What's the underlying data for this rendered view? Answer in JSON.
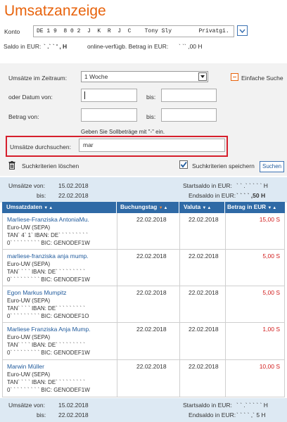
{
  "page": {
    "title": "Umsatzanzeige"
  },
  "account": {
    "label": "Konto",
    "selected": "DE 1 9  8 0 2  J  K  R  J  C    Tony Sly        Privatgi."
  },
  "balance_line": {
    "saldo_label": "Saldo in EUR:",
    "saldo_value": "` .` ` '  ,   H",
    "available_label": "online-verfügb. Betrag in EUR:",
    "available_value": "` `` ,00 H"
  },
  "filters": {
    "period_label": "Umsätze im Zeitraum:",
    "period_value": "1 Woche",
    "simple_search": "Einfache Suche",
    "date_from_label": "oder Datum von:",
    "date_to_label": "bis:",
    "amount_from_label": "Betrag von:",
    "amount_to_label": "bis:",
    "hint": "Geben Sie Sollbeträge mit \"-\" ein.",
    "search_label": "Umsätze durchsuchen:",
    "search_value": "mar",
    "clear_label": "Suchkriterien löschen",
    "save_label": "Suchkriterien speichern",
    "search_button": "Suchen"
  },
  "summary_top": {
    "from_label": "Umsätze von:",
    "from_value": "15.02.2018",
    "to_label": "bis:",
    "to_value": "22.02.2018",
    "start_label": "Startsaldo in EUR:",
    "start_value": "` ` .` ` ` ` ` H",
    "end_label": "Endsaldo in EUR:",
    "end_value": "` ` ` ` ,50 H"
  },
  "table": {
    "headers": [
      "Umsatzdaten",
      "Buchungstag",
      "Valuta",
      "Betrag in EUR"
    ],
    "rows": [
      {
        "name": "Marliese-Franziska AntoniaMu.",
        "line2": "Euro-UW (SEPA)",
        "line3": "TAN` 4` 1` IBAN: DE` ` ` ` ` ` ` ` `",
        "line4": "0` ` ` ` ` ` ` ` ` BIC: GENODEF1W",
        "buchungstag": "22.02.2018",
        "valuta": "22.02.2018",
        "betrag": "15,00 S"
      },
      {
        "name": "marliese-franziska anja mump.",
        "line2": "Euro-UW (SEPA)",
        "line3": "TAN` ` ` ` IBAN: DE` ` ` ` ` ` ` ` `",
        "line4": "0` ` ` ` ` ` ` ` ` BIC: GENODEF1W",
        "buchungstag": "22.02.2018",
        "valuta": "22.02.2018",
        "betrag": "5,00 S"
      },
      {
        "name": "Egon Markus Mumpitz",
        "line2": "Euro-UW (SEPA)",
        "line3": "TAN` ` ` ` IBAN: DE` ` ` ` ` ` ` ` `",
        "line4": "0` ` ` ` ` ` ` ` ` BIC: GENODEF1O",
        "buchungstag": "22.02.2018",
        "valuta": "22.02.2018",
        "betrag": "5,00 S"
      },
      {
        "name": "Marliese Franziska Anja Mump.",
        "line2": "Euro-UW (SEPA)",
        "line3": "TAN` ` ` ` IBAN: DE` ` ` ` ` ` ` ` `",
        "line4": "0` ` ` ` ` ` ` ` ` BIC: GENODEF1W",
        "buchungstag": "22.02.2018",
        "valuta": "22.02.2018",
        "betrag": "1,00 S"
      },
      {
        "name": "Marwin Müller",
        "line2": "Euro-UW (SEPA)",
        "line3": "TAN` ` ` ` IBAN: DE` ` ` ` ` ` ` ` `",
        "line4": "0` ` ` ` ` ` ` ` ` BIC: GENODEF1W",
        "buchungstag": "22.02.2018",
        "valuta": "22.02.2018",
        "betrag": "10,00 S"
      }
    ]
  },
  "summary_bottom": {
    "from_label": "Umsätze von:",
    "from_value": "15.02.2018",
    "to_label": "bis:",
    "to_value": "22.02.2018",
    "start_label": "Startsaldo in EUR:",
    "start_value": "` ` .` ` ` ` ` H",
    "end_label": "Endsaldo in EUR:",
    "end_value": "` ` ` ` ,` 5 H"
  },
  "colors": {
    "accent": "#e8630c",
    "header_blue": "#2f6aa6",
    "link_blue": "#1f5a9c",
    "debit_red": "#d11c1c",
    "highlight_red": "#d61f2c"
  }
}
